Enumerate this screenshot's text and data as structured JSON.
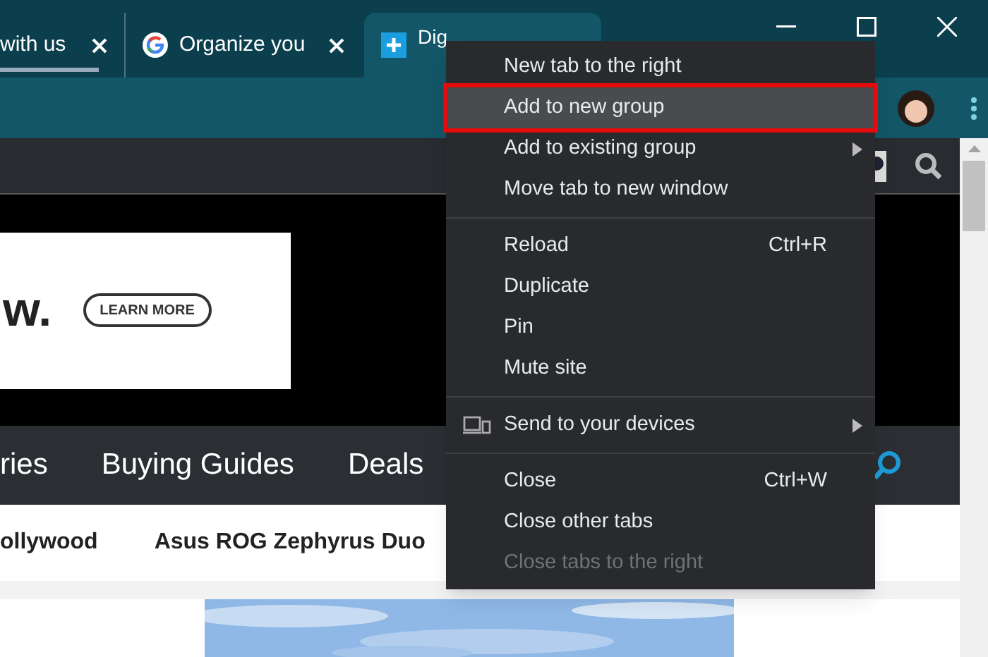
{
  "tabs": [
    {
      "title": "with us",
      "selected": false,
      "loading": true
    },
    {
      "title": "Organize you",
      "selected": false,
      "loading": false
    },
    {
      "title": "Dig",
      "selected": true,
      "loading": false
    }
  ],
  "ad": {
    "headline": "w.",
    "button": "LEARN MORE"
  },
  "nav": [
    "ries",
    "Buying Guides",
    "Deals"
  ],
  "trending": [
    "ollywood",
    "Asus ROG Zephyrus Duo"
  ],
  "article": {
    "image": {
      "kind": "picture"
    }
  },
  "context_menu": [
    [
      {
        "label": "New tab to the right",
        "selected": false
      },
      {
        "label": "Add to new group",
        "selected": true,
        "outlined": true
      },
      {
        "label": "Add to existing group",
        "submenu": true,
        "selected": false
      },
      {
        "label": "Move tab to new window",
        "selected": false
      }
    ],
    [
      {
        "label": "Reload",
        "shortcut": "Ctrl+R",
        "selected": false
      },
      {
        "label": "Duplicate",
        "selected": false
      },
      {
        "label": "Pin",
        "selected": false
      },
      {
        "label": "Mute site",
        "selected": false
      }
    ],
    [
      {
        "label": "Send to your devices",
        "submenu": true,
        "selected": false
      }
    ],
    [
      {
        "label": "Close",
        "shortcut": "Ctrl+W",
        "selected": false
      },
      {
        "label": "Close other tabs",
        "selected": false
      },
      {
        "label": "Close tabs to the right",
        "disabled": true,
        "selected": false
      }
    ]
  ]
}
